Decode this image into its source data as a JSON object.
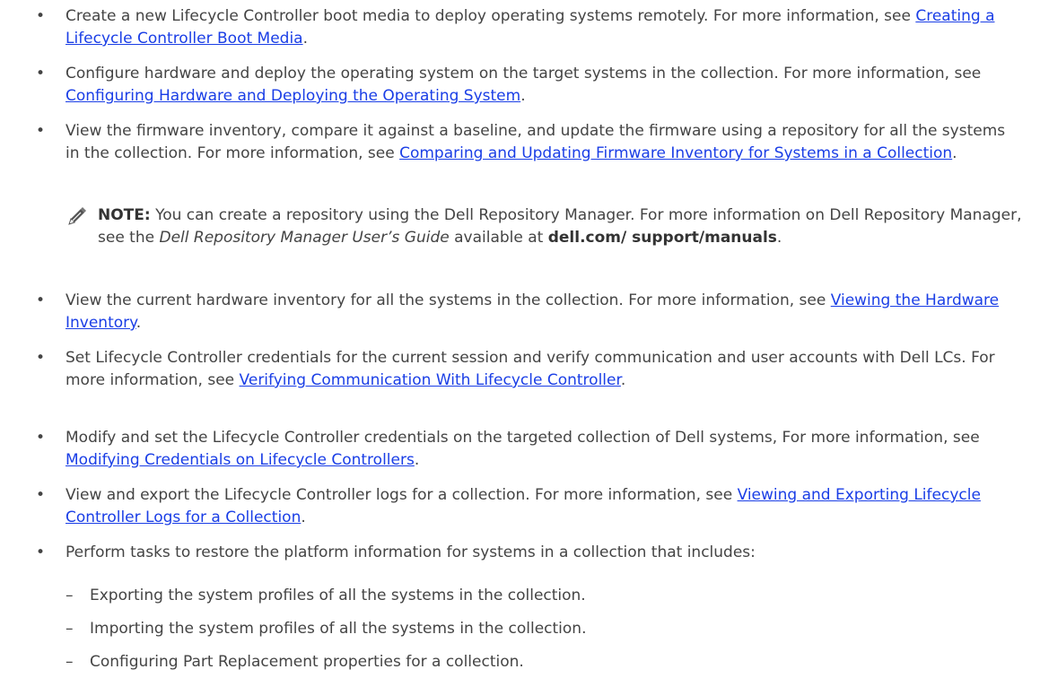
{
  "bullets": [
    {
      "text": "Create a new Lifecycle Controller boot media to deploy operating systems remotely. For more information, see ",
      "link": "Creating a Lifecycle Controller Boot Media",
      "after": "."
    },
    {
      "text": "Configure hardware and deploy the operating system on the target systems in the collection. For more information, see ",
      "link": "Configuring Hardware and Deploying the Operating System",
      "after": "."
    },
    {
      "text": "View the firmware inventory, compare it against a baseline, and update the firmware using a repository for all the systems in the collection. For more information, see ",
      "link": "Comparing and Updating Firmware Inventory for Systems in a Collection",
      "after": "."
    },
    {
      "text": "View the current hardware inventory for all the systems in the collection. For more information, see ",
      "link": "Viewing the Hardware Inventory",
      "after": "."
    },
    {
      "text": "Set Lifecycle Controller credentials for the current session and verify communication and user accounts with Dell LCs. For more information, see ",
      "link": "Verifying Communication With Lifecycle Controller",
      "after": "."
    },
    {
      "text": "Modify and set the Lifecycle Controller credentials on the targeted collection of Dell systems, For more information, see ",
      "link": "Modifying Credentials on Lifecycle Controllers",
      "after": "."
    },
    {
      "text": "View and export the Lifecycle Controller logs for a collection. For more information, see ",
      "link": "Viewing and Exporting Lifecycle Controller Logs for a Collection",
      "after": "."
    },
    {
      "text": "Perform tasks to restore the platform information for systems in a collection that includes:",
      "link": "",
      "after": ""
    }
  ],
  "bullet_symbol": "•",
  "note": {
    "label": "NOTE:",
    "text1": " You can create a repository using the Dell Repository Manager. For more information on Dell Repository Manager, see the ",
    "em": "Dell Repository Manager User’s Guide",
    "text2": " available at ",
    "strong": "dell.com/ support/manuals",
    "after": ".",
    "icon": "pencil-note-icon"
  },
  "sub_dash": "–",
  "sub_items": [
    "Exporting the system profiles of all the systems in the collection.",
    "Importing the system profiles of all the systems in the collection.",
    "Configuring Part Replacement properties for a collection."
  ],
  "colors": {
    "text": "#444444",
    "link": "#1a3ee6"
  }
}
